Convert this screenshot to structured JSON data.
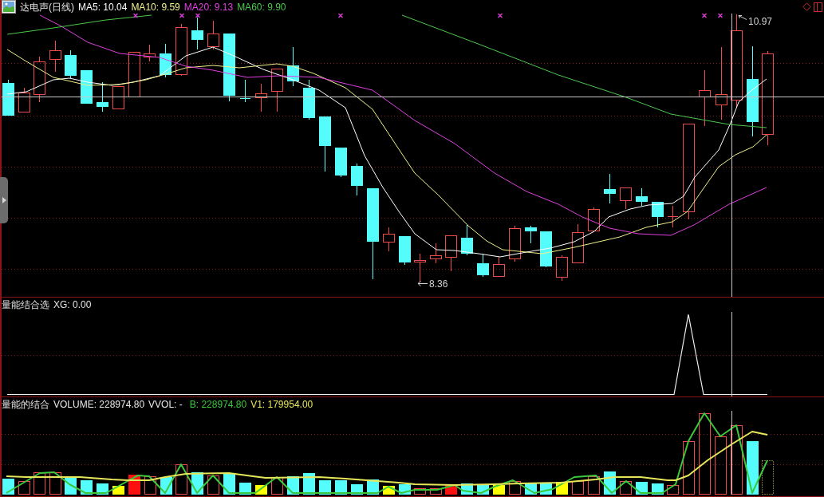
{
  "price_panel": {
    "title": "达电声(日线)",
    "indicators": [
      {
        "label": "MA5: 10.04",
        "color": "#ffffff"
      },
      {
        "label": "MA10: 9.59",
        "color": "#f0f08c"
      },
      {
        "label": "MA20: 9.13",
        "color": "#e040e0"
      },
      {
        "label": "MA60: 9.90",
        "color": "#4cc84c"
      }
    ],
    "high_label": "10.97",
    "low_label": "8.36"
  },
  "signal_panel": {
    "title": "量能结合选",
    "readout": "XG: 0.00"
  },
  "volume_panel": {
    "title": "量能的结合",
    "readouts": [
      {
        "label": "VOLUME: 228974.80",
        "color": "#e8e8e8"
      },
      {
        "label": "VVOL: -",
        "color": "#e8e8e8"
      },
      {
        "label": "B: 228974.80",
        "color": "#3cc83c"
      },
      {
        "label": "V1: 179954.00",
        "color": "#e6e65a"
      }
    ]
  }
}
